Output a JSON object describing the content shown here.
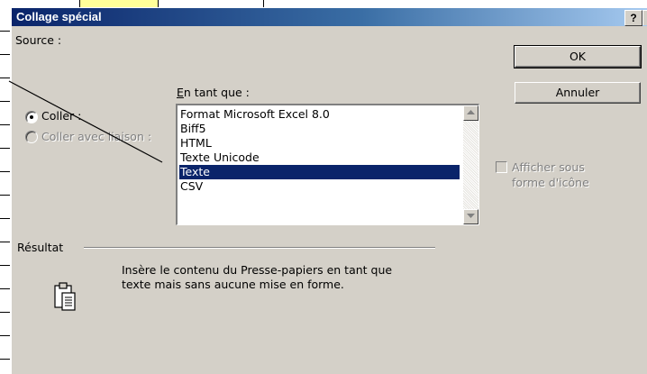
{
  "dialog": {
    "title": "Collage spécial",
    "help_label": "?",
    "source_label": "Source :",
    "as_label": "En tant que :",
    "as_label_accesskey": "E",
    "paste_option": "Coller :",
    "paste_link_option": "Coller avec liaison :",
    "ok_label": "OK",
    "cancel_label": "Annuler",
    "formats": [
      "Format Microsoft Excel 8.0",
      "Biff5",
      "HTML",
      "Texte Unicode",
      "Texte",
      "CSV"
    ],
    "selected_format": "Texte",
    "display_as_icon": "Afficher sous forme d'icône",
    "display_as_icon_line1": "Afficher sous",
    "display_as_icon_line2": "forme d'icône",
    "result_label": "Résultat",
    "result_text": "Insère le contenu du Presse-papiers en tant que texte mais sans aucune mise en forme."
  },
  "colors": {
    "title_start": "#0a246a",
    "title_end": "#a6caf0",
    "dialog_bg": "#d4d0c8",
    "selection": "#0a246a",
    "cell_highlight": "#ffff99"
  },
  "icons": [
    "help-icon",
    "scroll-up-icon",
    "scroll-down-icon",
    "clipboard-icon"
  ]
}
